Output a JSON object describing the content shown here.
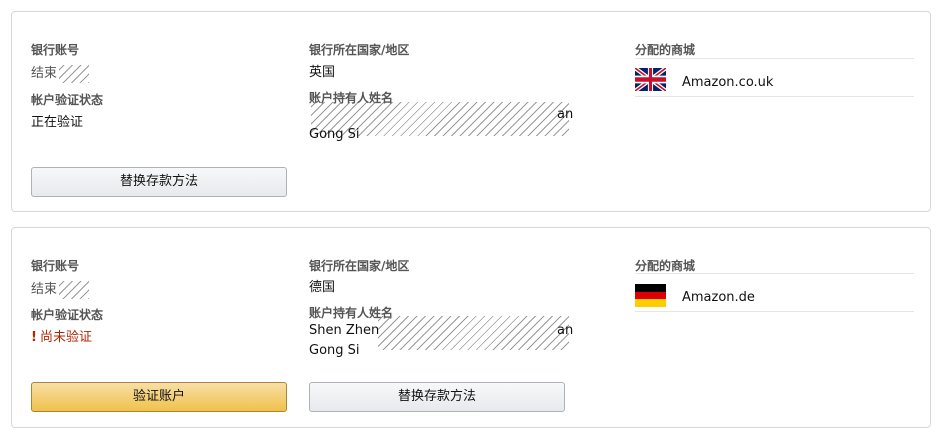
{
  "labels": {
    "account_number": "银行账号",
    "bank_country": "银行所在国家/地区",
    "assigned_marketplace": "分配的商城",
    "verification_status": "帐户验证状态",
    "account_holder": "账户持有人姓名"
  },
  "cards": [
    {
      "account_number_prefix": "结束",
      "country": "英国",
      "status": "正在验证",
      "holder_name_tail": "an",
      "holder_name_line2": "Gong Si",
      "marketplace": "Amazon.co.uk",
      "flag_icon": "uk-flag-icon",
      "replace_button": "替换存款方法"
    },
    {
      "account_number_prefix": "结束",
      "country": "德国",
      "status_bang": "!",
      "status": "尚未验证",
      "holder_name_head": "Shen Zhen",
      "holder_name_tail": "an",
      "holder_name_line2": "Gong Si",
      "marketplace": "Amazon.de",
      "flag_icon": "germany-flag-icon",
      "verify_button": "验证账户",
      "replace_button": "替换存款方法"
    }
  ],
  "colors": {
    "warning": "#b12704",
    "primary_button": "#f0c14b",
    "border": "#d5d9d9"
  }
}
